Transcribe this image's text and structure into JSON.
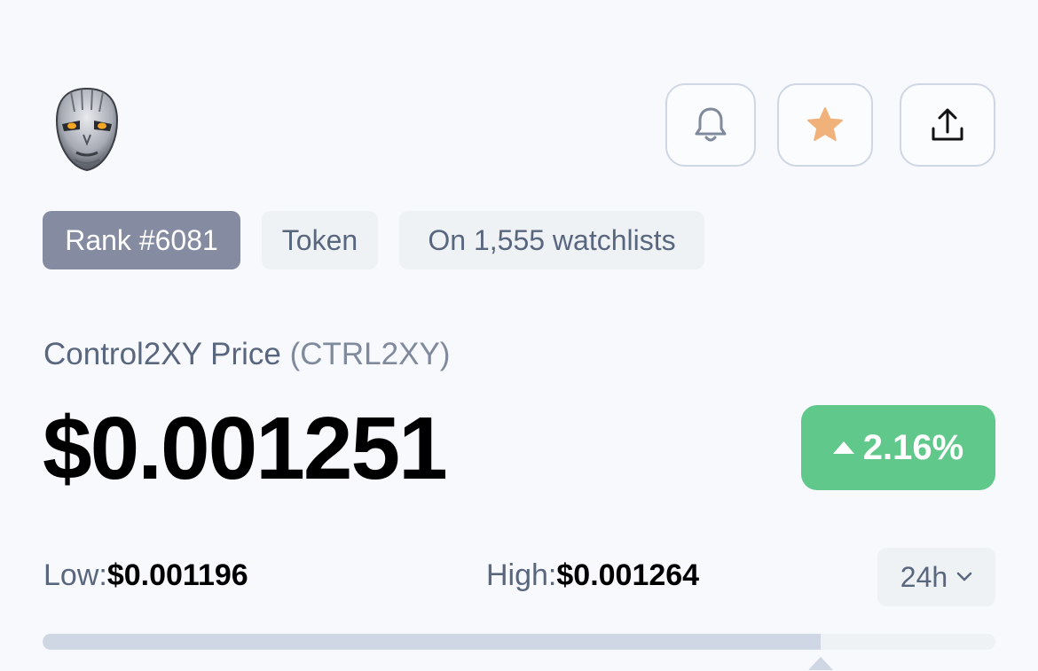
{
  "coin": {
    "logo_icon": "robot-face-logo",
    "name": "Control2XY",
    "price_word": "Price",
    "symbol": "(CTRL2XY)",
    "price": "$0.001251",
    "change": "2.16%",
    "change_direction": "up",
    "change_color": "#5fc88a"
  },
  "actions": {
    "bell_icon": "bell-icon",
    "star_icon": "star-icon",
    "star_color": "#f0b27a",
    "share_icon": "share-icon"
  },
  "tags": {
    "rank": "Rank #6081",
    "type": "Token",
    "watchlists": "On 1,555 watchlists"
  },
  "range": {
    "low_label": "Low:",
    "low_value": "$0.001196",
    "high_label": "High:",
    "high_value": "$0.001264",
    "period": "24h",
    "position_fraction": 0.817
  }
}
